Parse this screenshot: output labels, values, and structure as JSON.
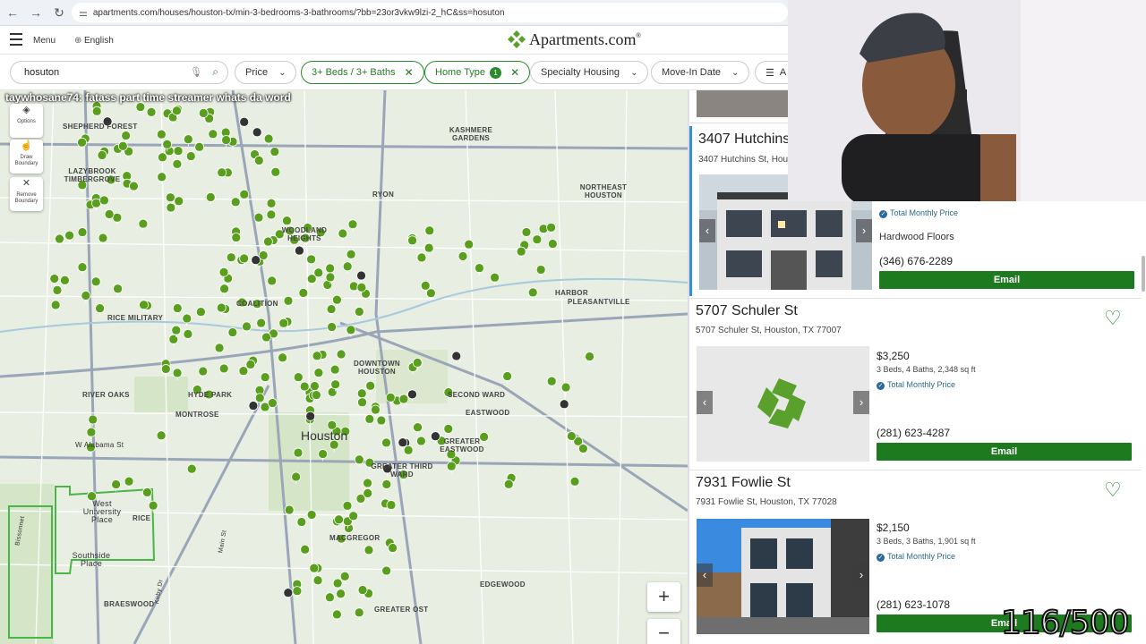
{
  "browser": {
    "url": "apartments.com/houses/houston-tx/min-3-bedrooms-3-bathrooms/?bb=23or3vkw9lzi-2_hC&ss=hosuton"
  },
  "header": {
    "menu_label": "Menu",
    "language_label": "English",
    "logo_text": "Apartments.com",
    "logo_suffix": "®"
  },
  "filters": {
    "search_value": "hosuton",
    "price_label": "Price",
    "beds_baths_label": "3+ Beds / 3+ Baths",
    "home_type_label": "Home Type",
    "home_type_count": "1",
    "specialty_label": "Specialty Housing",
    "move_in_label": "Move-In Date",
    "all_filters_label": "A"
  },
  "map": {
    "chat_user": "taywhosane74",
    "chat_message": ": fatass part time streamer whats da word",
    "city_label": "Houston",
    "tools": [
      {
        "label": "Options"
      },
      {
        "label": "Draw Boundary"
      },
      {
        "label": "Remove Boundary"
      }
    ],
    "neighborhoods": [
      "SHEPHERD FOREST",
      "LAZYBROOK TIMBERGROVE",
      "RYON",
      "KASHMERE GARDENS",
      "NORTHEAST HOUSTON",
      "WOODLAND HEIGHTS",
      "HARBOR",
      "PLEASANTVILLE",
      "RICE MILITARY",
      "COALITION",
      "DOWNTOWN HOUSTON",
      "RIVER OAKS",
      "HYDE PARK",
      "MONTROSE",
      "SECOND WARD",
      "EASTWOOD",
      "GREATER EASTWOOD",
      "GREATER THIRD WARD",
      "MACGREGOR",
      "BRAESWOOD",
      "GREATER OST",
      "EDGEWOOD",
      "West University Place",
      "Southside Place",
      "RICE",
      "W Alabama St",
      "Main St",
      "Kirby Dr",
      "Bissonnet"
    ],
    "zoom_in": "+",
    "zoom_out": "−"
  },
  "listings": [
    {
      "title": "3407 Hutchins",
      "address": "3407 Hutchins St, Hou",
      "total_monthly": "Total Monthly Price",
      "amenity": "Hardwood Floors",
      "phone": "(346) 676-2289",
      "email_label": "Email"
    },
    {
      "title": "5707 Schuler St",
      "address": "5707 Schuler St, Houston, TX 77007",
      "price": "$3,250",
      "specs": "3 Beds, 4 Baths, 2,348 sq ft",
      "total_monthly": "Total Monthly Price",
      "phone": "(281) 623-4287",
      "email_label": "Email"
    },
    {
      "title": "7931 Fowlie St",
      "address": "7931 Fowlie St, Houston, TX 77028",
      "price": "$2,150",
      "specs": "3 Beds, 3 Baths, 1,901 sq ft",
      "total_monthly": "Total Monthly Price",
      "phone": "(281) 623-1078",
      "email_label": "Email"
    }
  ],
  "overlay": {
    "counter": "116/500"
  },
  "colors": {
    "brand_green": "#2b8a2b",
    "email_green": "#1e7a1e",
    "map_bg": "#e8eee2",
    "pin_green": "#5a9e1e"
  }
}
